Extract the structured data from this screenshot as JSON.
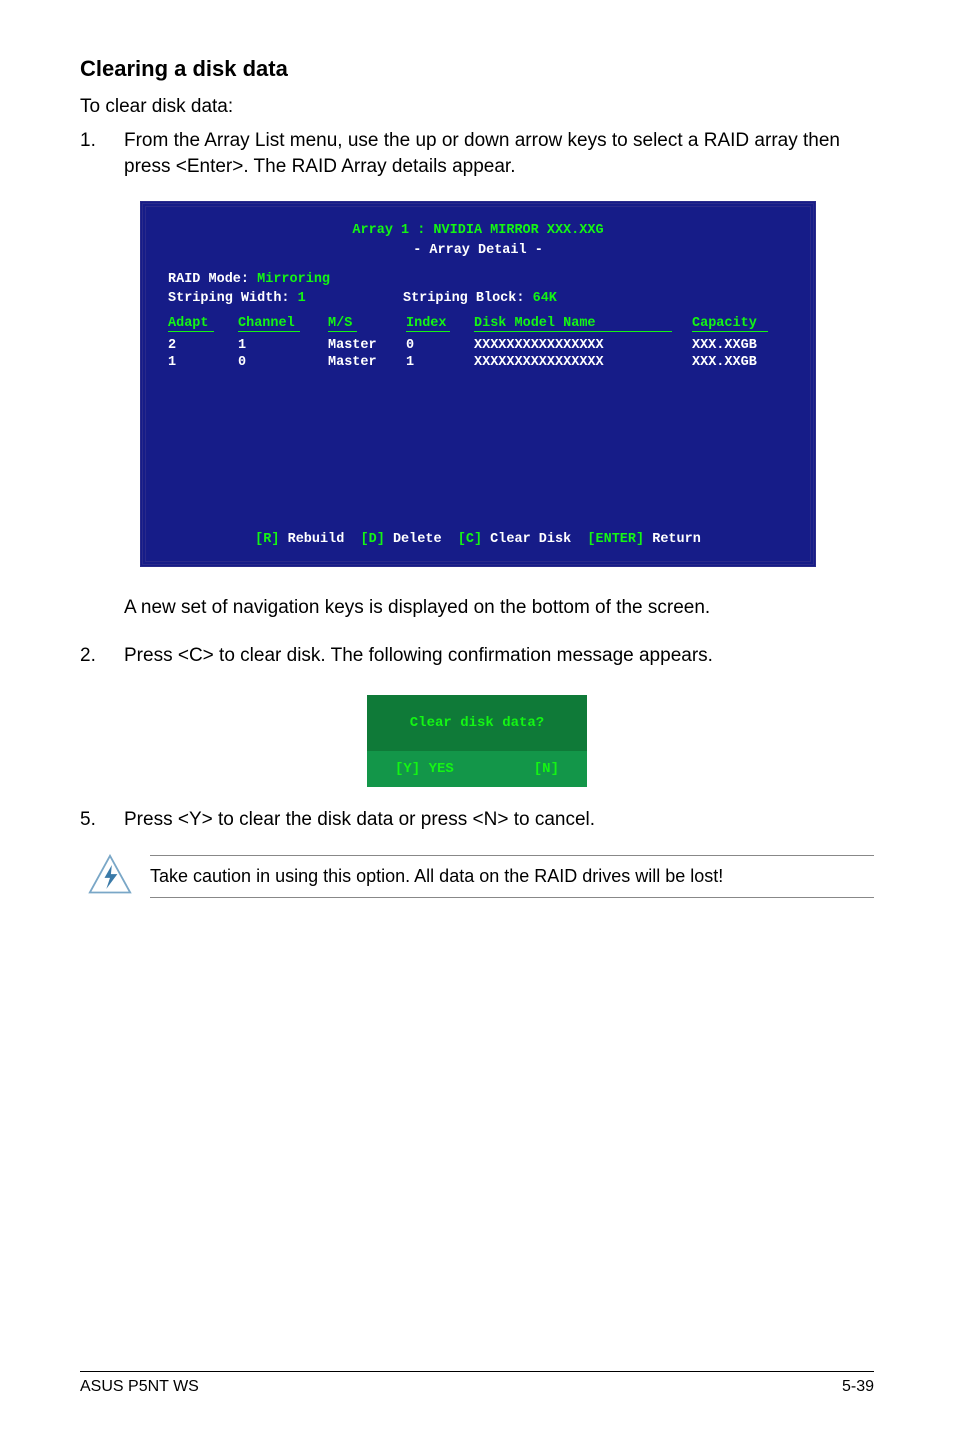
{
  "heading": "Clearing a disk data",
  "intro": "To clear disk data:",
  "step1": {
    "num": "1.",
    "text": "From the Array List menu, use the up or down arrow keys to select a RAID array then press <Enter>. The RAID Array details appear."
  },
  "bios": {
    "header_line1": "Array 1 : NVIDIA MIRROR  XXX.XXG",
    "header_line2": "- Array Detail -",
    "raid_mode_label": "RAID Mode:",
    "raid_mode_value": "Mirroring",
    "striping_width_label": "Striping Width:",
    "striping_width_value": "1",
    "striping_block_label": "Striping Block:",
    "striping_block_value": "64K",
    "cols": {
      "adapt": "Adapt",
      "channel": "Channel",
      "ms": "M/S",
      "index": "Index",
      "model": "Disk Model Name",
      "capacity": "Capacity"
    },
    "rows": [
      {
        "adapt": "2",
        "channel": "1",
        "ms": "Master",
        "index": "0",
        "model": "XXXXXXXXXXXXXXXX",
        "capacity": "XXX.XXGB"
      },
      {
        "adapt": "1",
        "channel": "0",
        "ms": "Master",
        "index": "1",
        "model": "XXXXXXXXXXXXXXXX",
        "capacity": "XXX.XXGB"
      }
    ],
    "footer": {
      "k1": "[R]",
      "l1": "Rebuild",
      "k2": "[D]",
      "l2": "Delete",
      "k3": "[C]",
      "l3": "Clear Disk",
      "k4": "[ENTER]",
      "l4": "Return"
    }
  },
  "after1": "A new set of  navigation keys is displayed on the bottom of the screen.",
  "step2": {
    "num": "2.",
    "text": "Press <C> to clear disk. The following confirmation message appears."
  },
  "dialog": {
    "title": "Clear disk data?",
    "yes": "[Y] YES",
    "no": "[N]"
  },
  "step5": {
    "num": "5.",
    "text": "Press <Y> to clear the disk data or press <N> to cancel."
  },
  "warning": "Take caution in using this option. All data on the RAID drives will be lost!",
  "footer": {
    "left": "ASUS P5NT WS",
    "right": "5-39"
  }
}
